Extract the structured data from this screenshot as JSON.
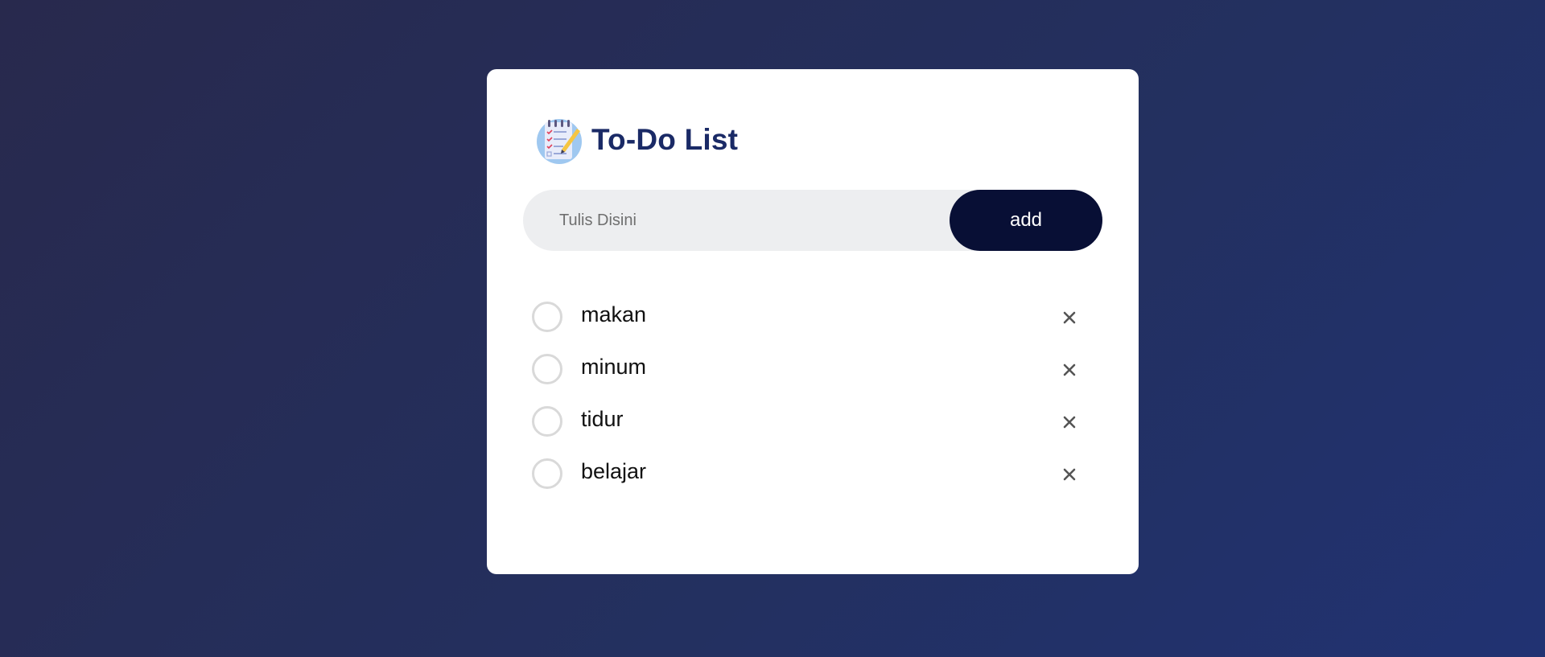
{
  "app": {
    "title": "To-Do List",
    "logo_icon": "notepad-checklist-icon"
  },
  "input": {
    "placeholder": "Tulis Disini",
    "value": ""
  },
  "add_button": {
    "label": "add"
  },
  "tasks": [
    {
      "label": "makan",
      "done": false
    },
    {
      "label": "minum",
      "done": false
    },
    {
      "label": "tidur",
      "done": false
    },
    {
      "label": "belajar",
      "done": false
    }
  ],
  "icons": {
    "check": "unchecked-circle-icon",
    "delete": "close-icon"
  },
  "colors": {
    "title": "#1a2a66",
    "button_bg": "#080f35",
    "input_bg": "#edeef0",
    "background_start": "#28294d",
    "background_end": "#213272"
  }
}
